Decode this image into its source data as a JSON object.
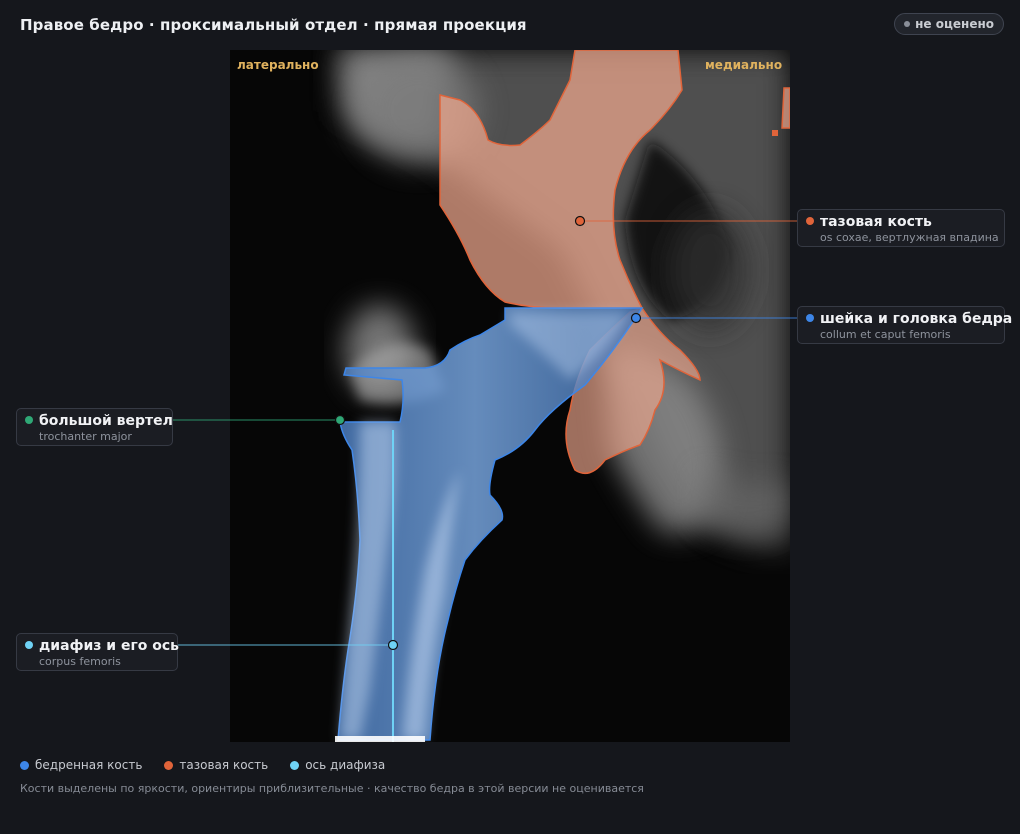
{
  "header": {
    "title": "Правое бедро · проксимальный отдел · прямая проекция",
    "status_label": "не оценено"
  },
  "orientation": {
    "left_label": "латерально",
    "right_label": "медиально"
  },
  "callouts": {
    "pelvis": {
      "title": "тазовая кость",
      "subtitle": "os coxae, вертлужная впадина",
      "color": "#e0643a"
    },
    "neck": {
      "title": "шейка и головка бедра",
      "subtitle": "collum et caput femoris",
      "color": "#3d86e8"
    },
    "trochanter": {
      "title": "большой вертел",
      "subtitle": "trochanter major",
      "color": "#2fa876"
    },
    "shaft": {
      "title": "диафиз и его ось",
      "subtitle": "corpus femoris",
      "color": "#6fd2f5"
    }
  },
  "legend": {
    "femur": {
      "label": "бедренная кость",
      "color": "#3d86e8"
    },
    "pelvis": {
      "label": "тазовая кость",
      "color": "#e0643a"
    },
    "axis": {
      "label": "ось диафиза",
      "color": "#6fd2f5"
    }
  },
  "footnote": "Кости выделены по яркости, ориентиры приблизительные · качество бедра в этой версии не оценивается",
  "colors": {
    "background": "#15171c",
    "femur_fill": "#5a8fd6",
    "pelvis_fill": "#f0a88e",
    "pelvis_outline": "#e0643a",
    "femur_outline": "#3d86e8",
    "axis_line": "#6fd2f5",
    "orientation_label": "#e0b25e"
  },
  "icons": {
    "status": "status-dot-icon",
    "legend": "legend-dot-icon"
  }
}
